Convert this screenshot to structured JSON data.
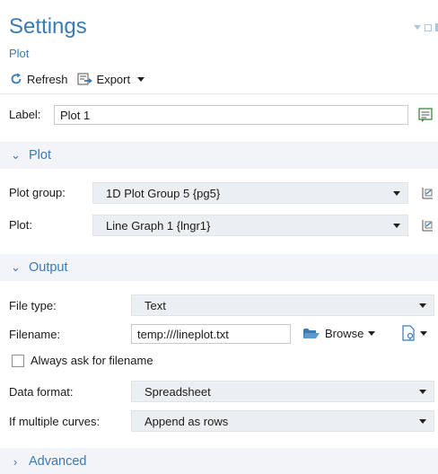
{
  "header": {
    "title": "Settings",
    "subtitle": "Plot",
    "refresh_label": "Refresh",
    "export_label": "Export"
  },
  "label_row": {
    "label": "Label:",
    "value": "Plot 1"
  },
  "plot_section": {
    "title": "Plot",
    "expanded": true,
    "plot_group_label": "Plot group:",
    "plot_group_value": "1D Plot Group 5 {pg5}",
    "plot_label": "Plot:",
    "plot_value": "Line Graph 1 {lngr1}"
  },
  "output_section": {
    "title": "Output",
    "expanded": true,
    "file_type_label": "File type:",
    "file_type_value": "Text",
    "filename_label": "Filename:",
    "filename_value": "temp:///lineplot.txt",
    "browse_label": "Browse",
    "always_ask_label": "Always ask for filename",
    "always_ask_checked": false,
    "data_format_label": "Data format:",
    "data_format_value": "Spreadsheet",
    "multiple_curves_label": "If multiple curves:",
    "multiple_curves_value": "Append as rows"
  },
  "advanced_section": {
    "title": "Advanced",
    "expanded": false
  },
  "colors": {
    "accent": "#3a7ab5",
    "section_bg": "#f2f4f7",
    "dropdown_bg": "#eceff2"
  }
}
